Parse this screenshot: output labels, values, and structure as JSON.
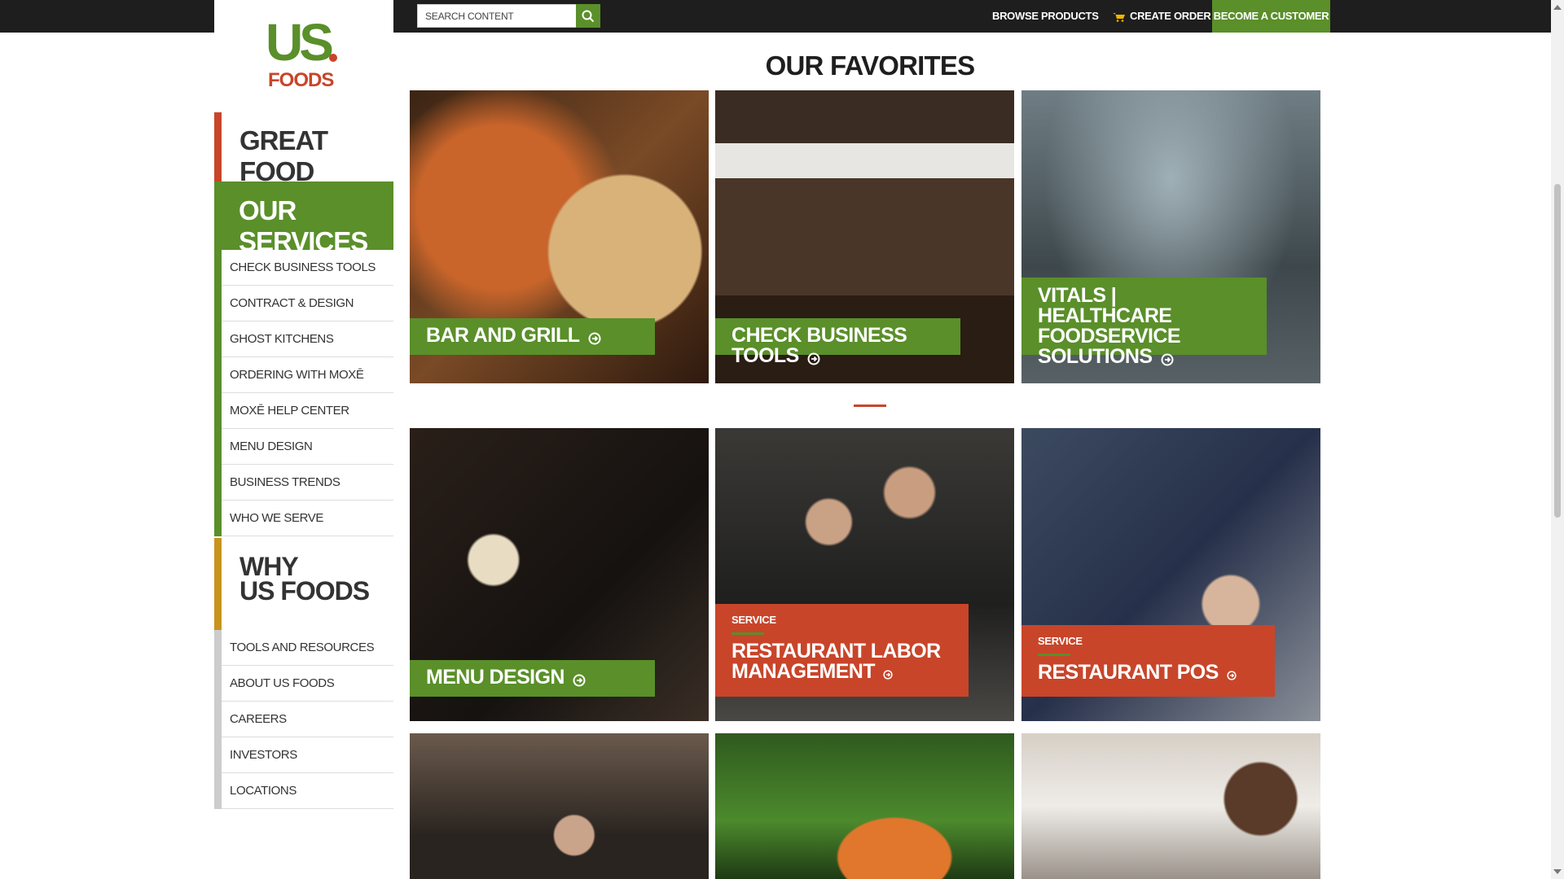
{
  "header": {
    "search_placeholder": "SEARCH CONTENT",
    "browse_products": "BROWSE PRODUCTS",
    "create_order": "CREATE ORDER",
    "become_customer": "BECOME A CUSTOMER"
  },
  "logo": {
    "us": "US",
    "foods": "FOODS"
  },
  "sidebar": {
    "great_food": "GREAT FOOD",
    "our_services": "OUR SERVICES",
    "services_items": [
      "CHECK BUSINESS TOOLS",
      "CONTRACT & DESIGN",
      "GHOST KITCHENS",
      "ORDERING WITH MOXĒ",
      "MOXĒ HELP CENTER",
      "MENU DESIGN",
      "BUSINESS TRENDS",
      "WHO WE SERVE"
    ],
    "why_us_foods": "WHY\nUS FOODS",
    "why_items": [
      "TOOLS AND RESOURCES",
      "ABOUT US FOODS",
      "CAREERS",
      "INVESTORS",
      "LOCATIONS"
    ]
  },
  "main": {
    "title": "OUR FAVORITES",
    "tiles": [
      {
        "title": "BAR AND GRILL"
      },
      {
        "title": "CHECK BUSINESS TOOLS"
      },
      {
        "title": "VITALS | HEALTHCARE FOODSERVICE SOLUTIONS"
      },
      {
        "title": "MENU DESIGN"
      },
      {
        "kicker": "SERVICE",
        "title": "RESTAURANT LABOR MANAGEMENT"
      },
      {
        "kicker": "SERVICE",
        "title": "RESTAURANT POS"
      }
    ]
  },
  "colors": {
    "brand_green": "#5a8f2a",
    "brand_orange": "#c8452a",
    "topbar": "#1e1e1e",
    "why_accent": "#c8941e"
  }
}
